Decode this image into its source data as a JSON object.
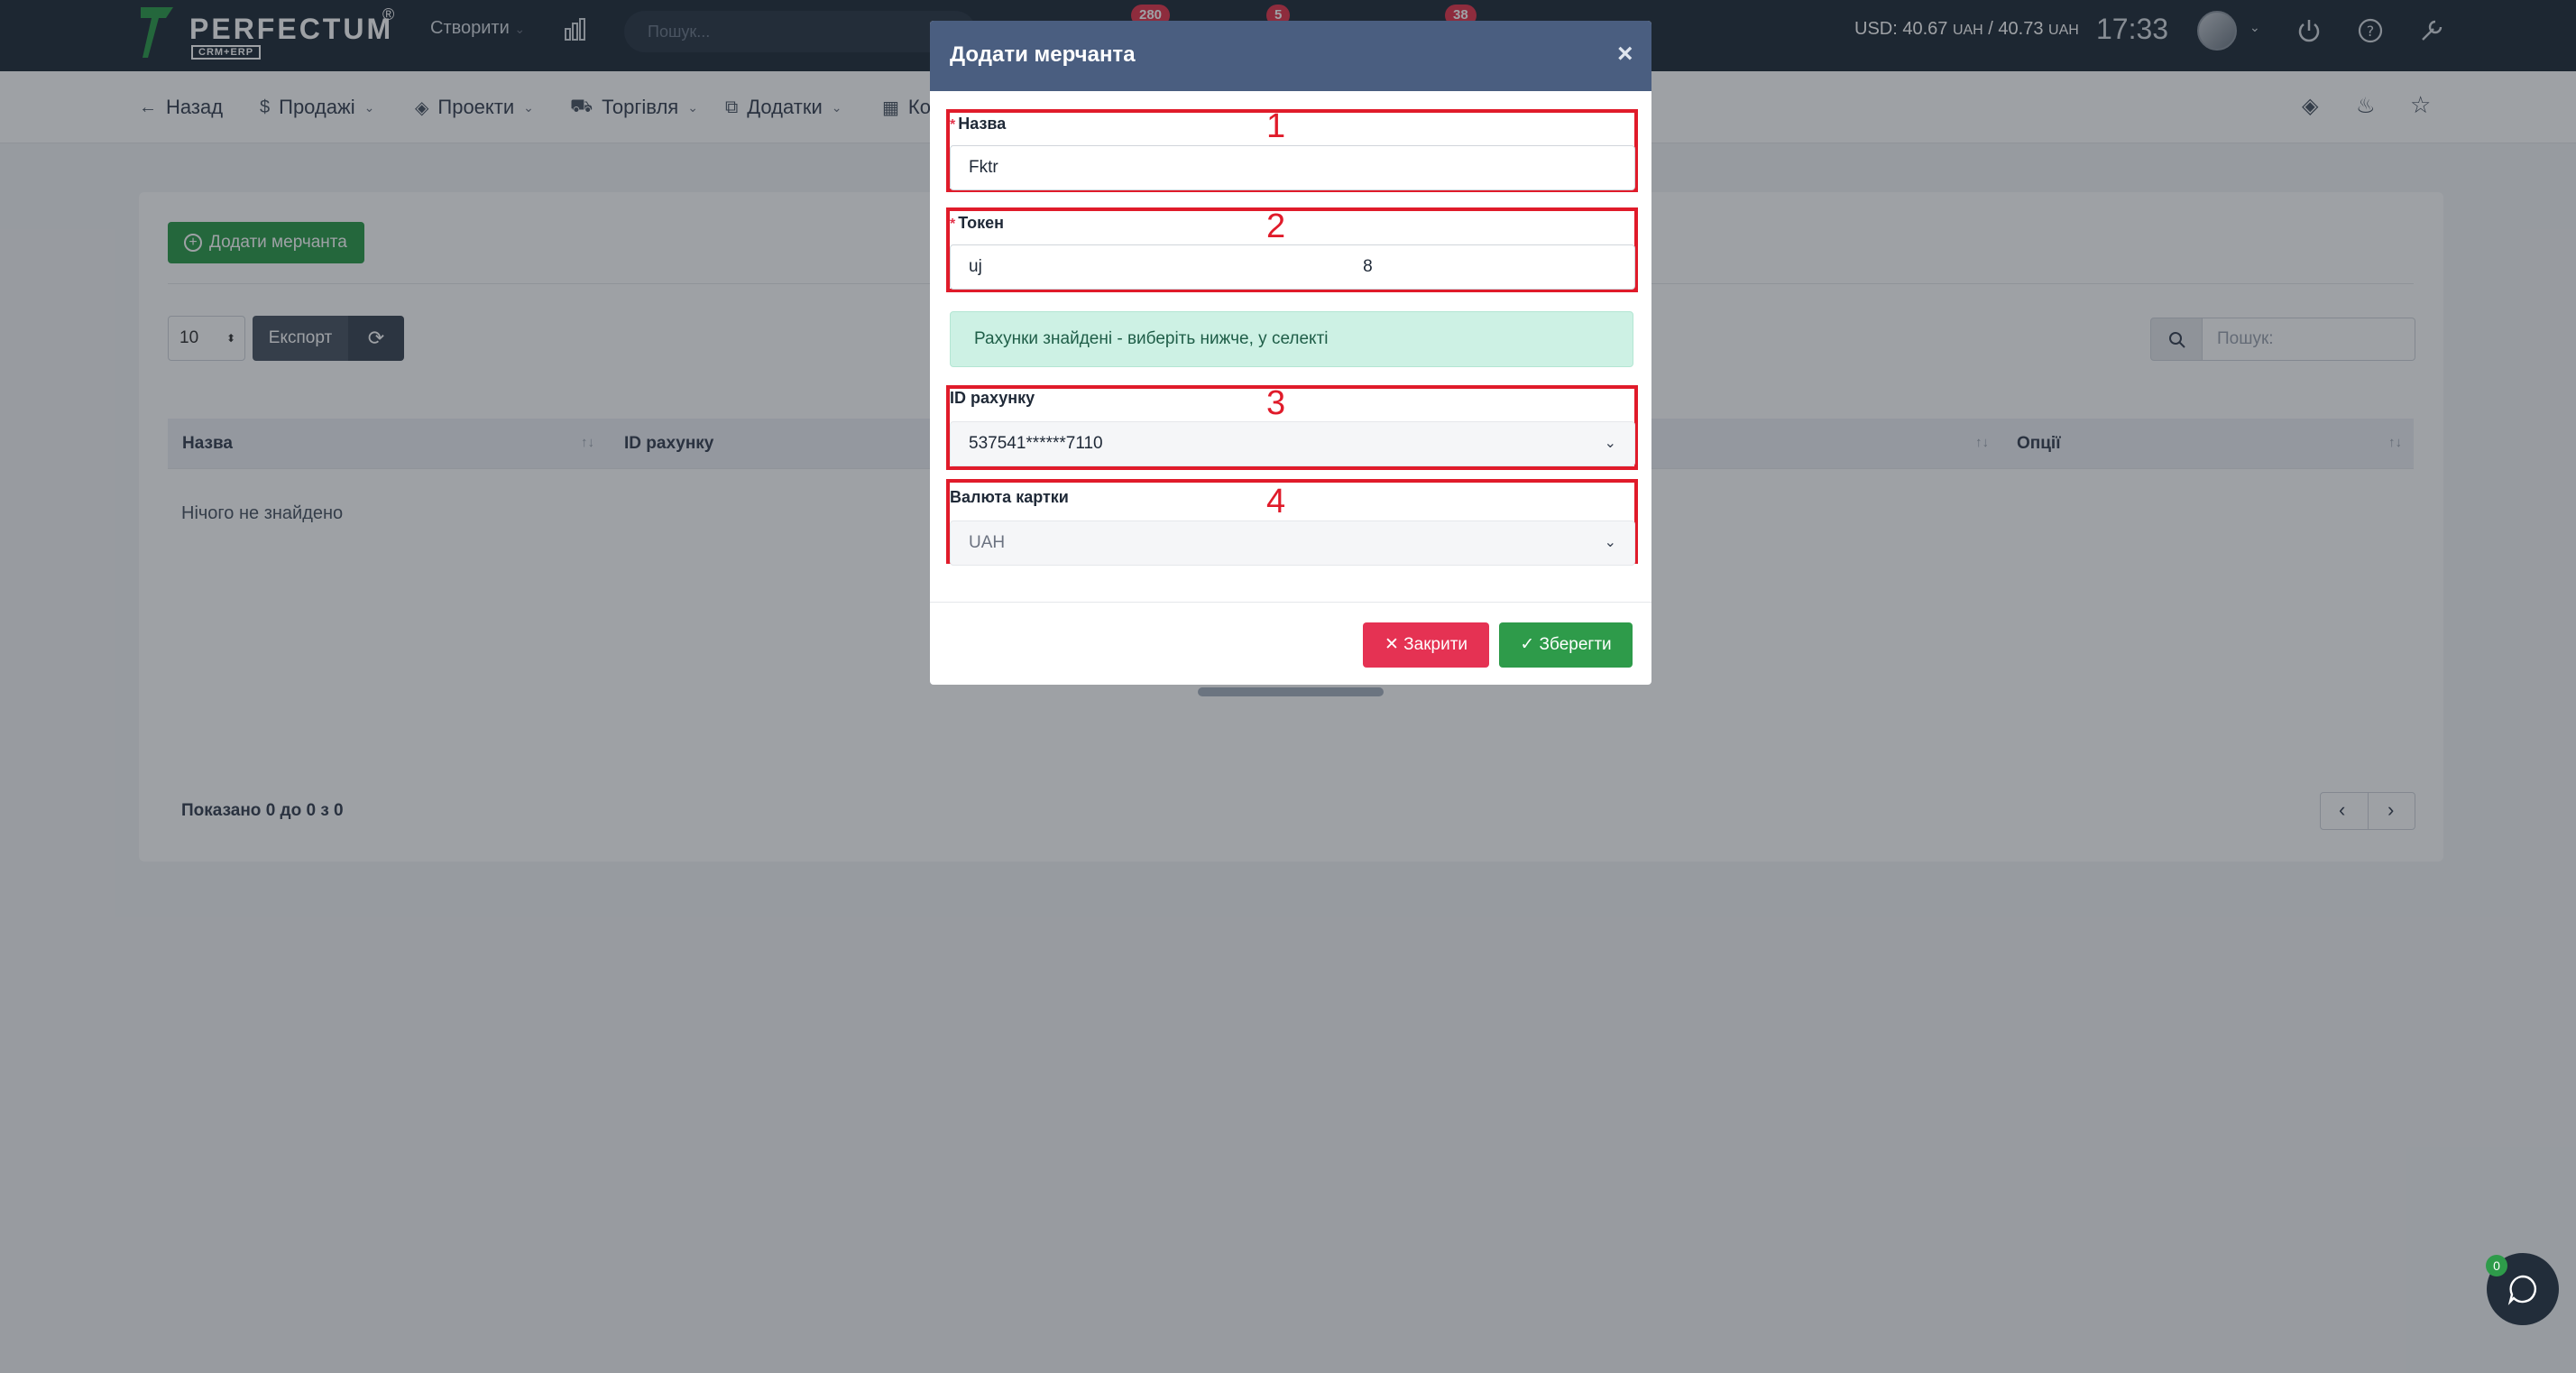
{
  "topbar": {
    "logo_text": "PERFECTUM",
    "logo_reg": "®",
    "logo_sub": "CRM+ERP",
    "create_label": "Створити",
    "search_placeholder": "Пошук...",
    "badges": [
      "280",
      "5",
      "38"
    ],
    "currency_usd": "USD: 40.67",
    "currency_unit1": "UAH",
    "currency_sep": "/ 40.73",
    "currency_unit2": "UAH",
    "clock": "17:33"
  },
  "subnav": {
    "back": "Назад",
    "items": [
      "Продажі",
      "Проекти",
      "Торгівля",
      "Додатки",
      "Ко"
    ]
  },
  "page": {
    "add_button": "Додати мерчанта",
    "page_length": "10",
    "export_label": "Експорт",
    "search_placeholder": "Пошук:",
    "columns": [
      "Назва",
      "ID рахунку",
      "Опції"
    ],
    "empty_text": "Нічого не знайдено",
    "shown_text": "Показано 0 до 0 з 0"
  },
  "modal": {
    "title": "Додати мерчанта",
    "close_symbol": "×",
    "fields": {
      "name_label": "Назва",
      "name_value": "Fktr",
      "token_label": "Токен",
      "token_value": "uj                                                                                8",
      "alert_text": "Рахунки знайдені - виберіть нижче, у селекті",
      "account_label": "ID рахунку",
      "account_value": "537541******7110",
      "currency_label": "Валюта картки",
      "currency_value": "UAH"
    },
    "annotations": [
      "1",
      "2",
      "3",
      "4"
    ],
    "close_button": "Закрити",
    "save_button": "Зберегти"
  },
  "chat": {
    "badge": "0"
  },
  "colors": {
    "topbar": "#222d3a",
    "modal_header": "#4a5e80",
    "success": "#2e9b4a",
    "danger": "#e53253",
    "annotation": "#e01b2a"
  }
}
